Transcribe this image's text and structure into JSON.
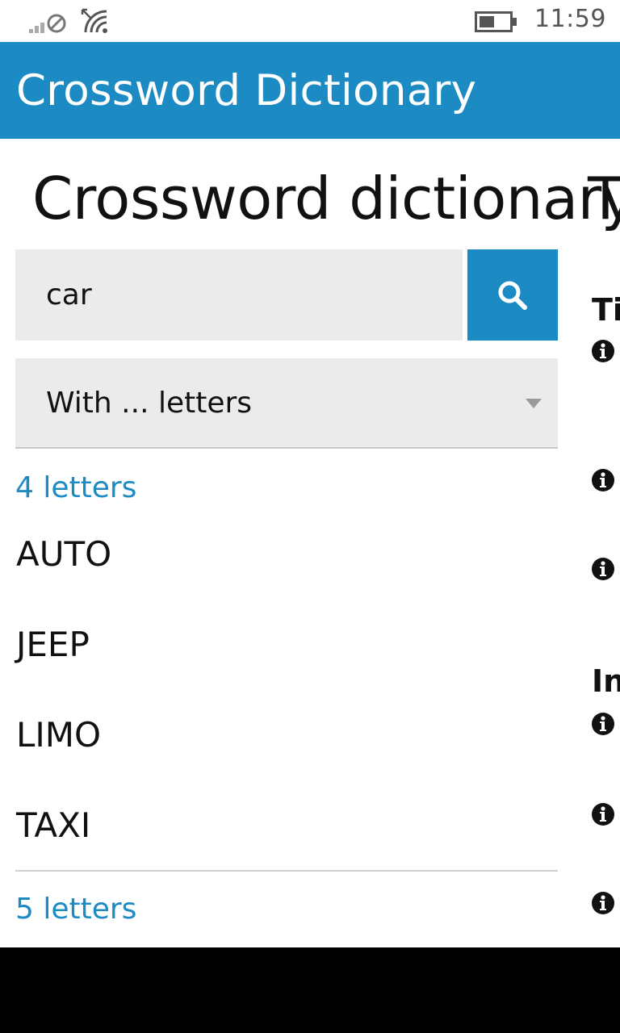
{
  "status_bar": {
    "time": "11:59",
    "icons": [
      "signal-icon",
      "wifi-icon",
      "battery-icon"
    ]
  },
  "app_bar": {
    "title": "Crossword Dictionary",
    "color": "#1c8bc4"
  },
  "page": {
    "heading": "Crossword dictionary",
    "next_section_heading": "T"
  },
  "search": {
    "value": "car",
    "button_icon": "search-icon"
  },
  "filter": {
    "selected": "With ... letters"
  },
  "results": {
    "groups": [
      {
        "header": "4 letters",
        "words": [
          "AUTO",
          "JEEP",
          "LIMO",
          "TAXI"
        ]
      },
      {
        "header": "5 letters",
        "words": []
      }
    ]
  },
  "side_panel": {
    "section_labels": [
      "Ti",
      "In"
    ],
    "info_icon_count": 6
  },
  "colors": {
    "accent": "#1c8bc4",
    "input_background": "#ebebeb",
    "nav_bar": "#000000"
  }
}
